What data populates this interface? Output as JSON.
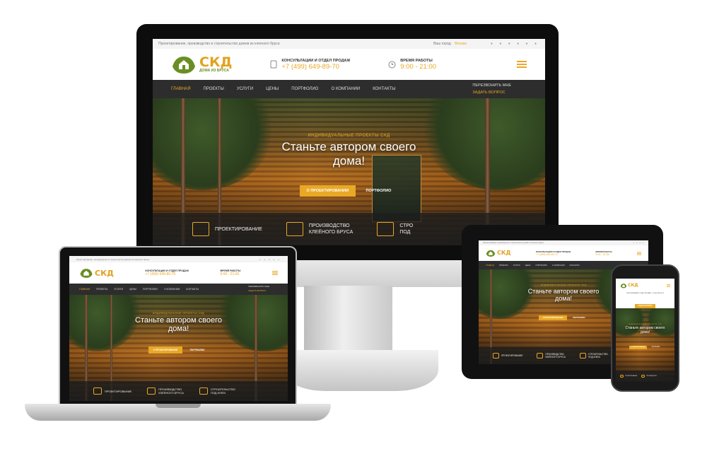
{
  "site": {
    "tagline": "Проектирование, производство и строительство домов из клееного бруса",
    "city_label": "Ваш город:",
    "city_value": "Москва",
    "logo_text": "СКД",
    "logo_sub": "ДОМА ИЗ БРУСА",
    "consult_label": "КОНСУЛЬТАЦИИ И ОТДЕЛ ПРОДАЖ",
    "phone": "+7 (499) 649-89-70",
    "phone_short": "+7 (499) 649-89-70",
    "hours_label": "ВРЕМЯ РАБОТЫ",
    "hours": "9:00 - 21:00",
    "nav": [
      "ГЛАВНАЯ",
      "ПРОЕКТЫ",
      "УСЛУГИ",
      "ЦЕНЫ",
      "ПОРТФОЛИО",
      "О КОМПАНИИ",
      "КОНТАКТЫ"
    ],
    "callback": "ПЕРЕЗВОНИТЬ МНЕ",
    "ask": "ЗАДАТЬ ВОПРОС",
    "hero_sub": "ИНДИВИДУАЛЬНЫЕ ПРОЕКТЫ СКД",
    "hero_title_1": "Станьте автором своего",
    "hero_title_2": "дома!",
    "btn_primary": "О ПРОЕКТИРОВАНИИ",
    "btn_secondary": "ПОРТФОЛИО",
    "features": [
      {
        "l1": "ПРОЕКТИРОВАНИЕ",
        "l2": ""
      },
      {
        "l1": "ПРОИЗВОДСТВО",
        "l2": "КЛЕЁНОГО БРУСА"
      },
      {
        "l1": "СТРОИТЕЛЬСТВО",
        "l2": "ПОД КЛЮЧ"
      }
    ],
    "imac_feature3": [
      "СТРО",
      "ПОД"
    ],
    "phone_button": "ЗАДАТЬ ВОПРОС",
    "phone_header_line": "КОНСУЛЬТАЦИИ И ОТДЕЛ ПРОДАЖ: +7 (499) 649-89-70"
  },
  "colors": {
    "accent": "#e9a826",
    "logo_green": "#6b8e23",
    "nav_bg": "#2d2d2d",
    "feature_bg": "rgba(30,30,30,0.78)"
  },
  "icons": [
    "phone-icon",
    "clock-icon",
    "hamburger-icon",
    "house-plan-icon",
    "beam-icon",
    "handshake-icon",
    "social-icons"
  ]
}
